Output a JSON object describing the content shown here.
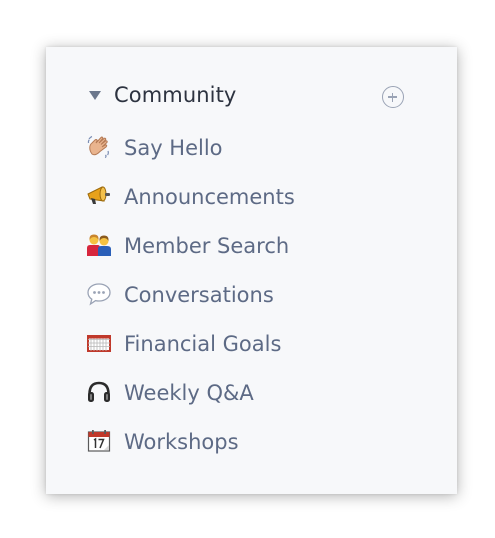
{
  "section": {
    "title": "Community",
    "collapse_icon": "caret-down-icon",
    "add_icon": "circle-plus-icon"
  },
  "channels": [
    {
      "label": "Say Hello",
      "icon": "waving-hand-icon"
    },
    {
      "label": "Announcements",
      "icon": "megaphone-icon"
    },
    {
      "label": "Member Search",
      "icon": "people-icon"
    },
    {
      "label": "Conversations",
      "icon": "speech-bubble-icon"
    },
    {
      "label": "Financial Goals",
      "icon": "goal-net-icon"
    },
    {
      "label": "Weekly Q&A",
      "icon": "headphones-icon"
    },
    {
      "label": "Workshops",
      "icon": "calendar-icon"
    }
  ],
  "colors": {
    "panel_bg": "#f7f8fa",
    "title": "#2d3340",
    "label": "#5d6a85",
    "muted": "#9aa3b5"
  }
}
